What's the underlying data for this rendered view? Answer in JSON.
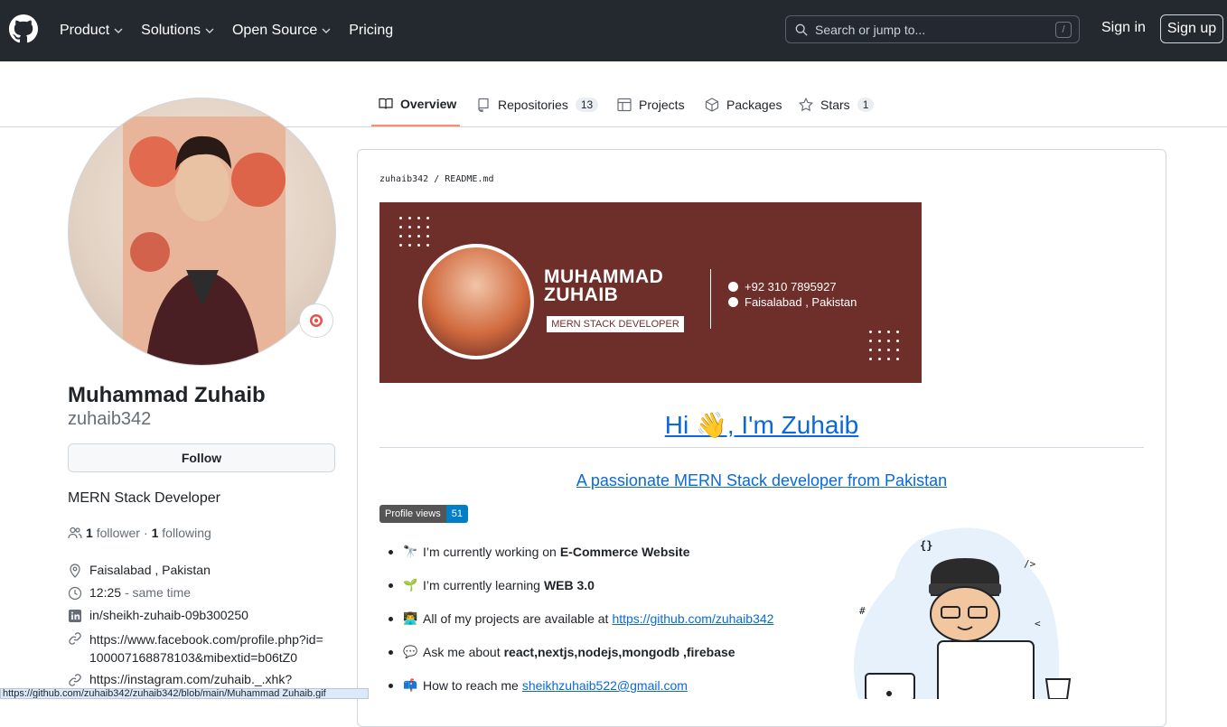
{
  "header": {
    "nav": [
      "Product",
      "Solutions",
      "Open Source",
      "Pricing"
    ],
    "search_placeholder": "Search or jump to...",
    "search_shortcut": "/",
    "signin": "Sign in",
    "signup": "Sign up"
  },
  "tabs": [
    {
      "label": "Overview",
      "count": null,
      "icon": "book-icon",
      "active": true
    },
    {
      "label": "Repositories",
      "count": "13",
      "icon": "repo-icon"
    },
    {
      "label": "Projects",
      "count": null,
      "icon": "table-icon"
    },
    {
      "label": "Packages",
      "count": null,
      "icon": "package-icon"
    },
    {
      "label": "Stars",
      "count": "1",
      "icon": "star-icon"
    }
  ],
  "profile": {
    "fullname": "Muhammad Zuhaib",
    "username": "zuhaib342",
    "follow_label": "Follow",
    "bio": "MERN Stack Developer",
    "followers": "1",
    "followers_label": "follower",
    "following": "1",
    "following_label": "following",
    "location": "Faisalabad , Pakistan",
    "time": "12:25",
    "time_note": "- same time",
    "linkedin": "in/sheikh-zuhaib-09b300250",
    "facebook": "https://www.facebook.com/profile.php?id=100007168878103&mibextid=b06tZ0",
    "instagram": "https://instagram.com/zuhaib._.xhk?"
  },
  "readme": {
    "path_user": "zuhaib342",
    "path_sep": "/",
    "path_file": "README.md",
    "banner": {
      "name_line1": "MUHAMMAD",
      "name_line2": "ZUHAIB",
      "role": "MERN STACK DEVELOPER",
      "phone": "+92 310 7895927",
      "location": "Faisalabad , Pakistan"
    },
    "heading": "Hi 👋, I'm Zuhaib",
    "tagline": "A passionate MERN Stack developer from Pakistan",
    "badge_label": "Profile views",
    "badge_value": "51",
    "bullets": [
      {
        "emoji": "🔭",
        "text": "I’m currently working on",
        "bold": "E-Commerce Website"
      },
      {
        "emoji": "🌱",
        "text": "I’m currently learning",
        "bold": "WEB 3.0"
      },
      {
        "emoji": "👨‍💻",
        "text": "All of my projects are available at",
        "link": "https://github.com/zuhaib342"
      },
      {
        "emoji": "💬",
        "text": "Ask me about",
        "bold": "react,nextjs,nodejs,mongodb ,firebase"
      },
      {
        "emoji": "📫",
        "text": "How to reach me",
        "link": "sheikhzuhaib522@gmail.com"
      }
    ]
  },
  "statusbar": "https://github.com/zuhaib342/zuhaib342/blob/main/Muhammad Zuhaib.gif",
  "colors": {
    "header_bg": "#24292f",
    "link": "#0969da",
    "banner_bg": "#6e2f2b",
    "tab_accent": "#fd8c73"
  }
}
